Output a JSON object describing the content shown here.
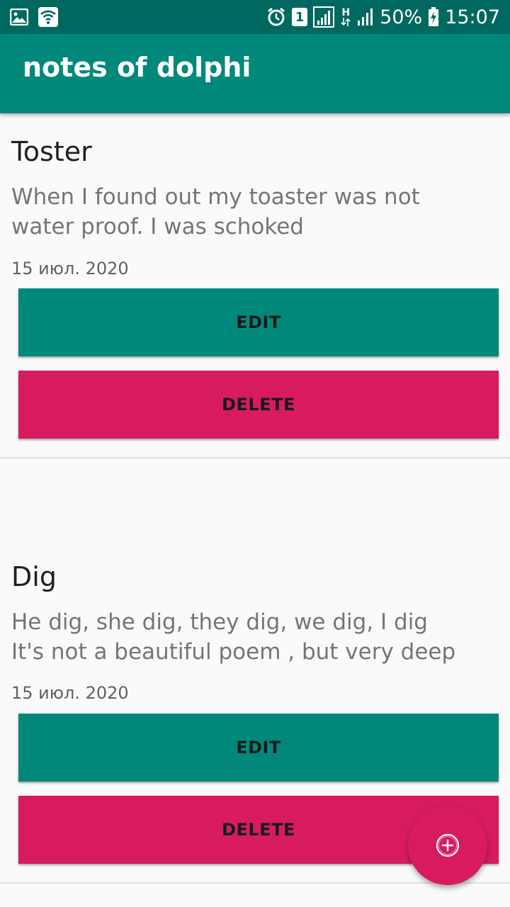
{
  "status_bar": {
    "battery_percent": "50%",
    "time": "15:07",
    "sim_label": "1",
    "network_type": "H",
    "icons": [
      "image-icon",
      "wifi-icon",
      "alarm-icon",
      "sim-icon",
      "signal-icon",
      "mobile-data-icon",
      "signal-icon-2",
      "battery-charging-icon"
    ]
  },
  "app_bar": {
    "title": "notes of dolphi"
  },
  "notes": [
    {
      "title": "Toster",
      "body": "When I found out my toaster was not\nwater proof. I was schoked",
      "date": "15 июл. 2020",
      "edit_label": "EDIT",
      "delete_label": "DELETE"
    },
    {
      "title": "Dig",
      "body": "He dig, she dig, they dig, we dig, I dig\nIt's not a beautiful poem , but very deep",
      "date": "15 июл. 2020",
      "edit_label": "EDIT",
      "delete_label": "DELETE"
    }
  ],
  "fab": {
    "icon": "add-circle-icon"
  },
  "colors": {
    "status_bar": "#00695f",
    "primary": "#00897b",
    "accent": "#d81b60",
    "background": "#fafafa"
  }
}
